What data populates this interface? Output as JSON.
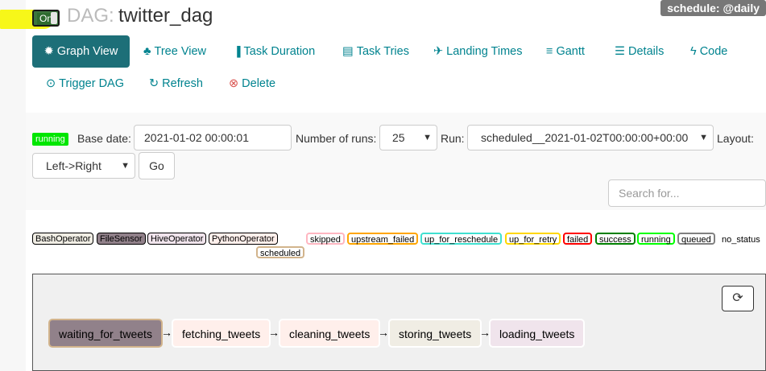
{
  "header": {
    "toggle_label": "On",
    "dag_prefix": "DAG:",
    "dag_id": "twitter_dag",
    "schedule": "schedule: @daily"
  },
  "nav": {
    "graph_view": "Graph View",
    "tree_view": "Tree View",
    "task_duration": "Task Duration",
    "task_tries": "Task Tries",
    "landing_times": "Landing Times",
    "gantt": "Gantt",
    "details": "Details",
    "code": "Code",
    "trigger_dag": "Trigger DAG",
    "refresh": "Refresh",
    "delete": "Delete"
  },
  "controls": {
    "run_state": "running",
    "base_date_label": "Base date:",
    "base_date_value": "2021-01-02 00:00:01",
    "num_runs_label": "Number of runs:",
    "num_runs_value": "25",
    "run_label": "Run:",
    "run_value": "scheduled__2021-01-02T00:00:00+00:00",
    "layout_label": "Layout:",
    "layout_value": "Left->Right",
    "go_label": "Go",
    "search_placeholder": "Search for..."
  },
  "operators": [
    {
      "label": "BashOperator",
      "color": "#f0ede4"
    },
    {
      "label": "FileSensor",
      "color": "#91818a"
    },
    {
      "label": "HiveOperator",
      "color": "#f0e4ec"
    },
    {
      "label": "PythonOperator",
      "color": "#ffefeb"
    }
  ],
  "scheduled_label": "scheduled",
  "states": [
    {
      "label": "skipped",
      "border": "#ffb6c1"
    },
    {
      "label": "upstream_failed",
      "border": "#ffa500"
    },
    {
      "label": "up_for_reschedule",
      "border": "#40e0d0"
    },
    {
      "label": "up_for_retry",
      "border": "#ffd700"
    },
    {
      "label": "failed",
      "border": "#ff0000"
    },
    {
      "label": "success",
      "border": "#008000"
    },
    {
      "label": "running",
      "border": "#00ff00"
    },
    {
      "label": "queued",
      "border": "#808080"
    },
    {
      "label": "no_status",
      "border": "transparent"
    }
  ],
  "tasks": [
    {
      "label": "waiting_for_tweets",
      "color": "#91818a",
      "state_border": "#d2b48c"
    },
    {
      "label": "fetching_tweets",
      "color": "#ffefeb",
      "state_border": "#ffffff"
    },
    {
      "label": "cleaning_tweets",
      "color": "#ffefeb",
      "state_border": "#ffffff"
    },
    {
      "label": "storing_tweets",
      "color": "#f0ede4",
      "state_border": "#ffffff"
    },
    {
      "label": "loading_tweets",
      "color": "#f0e4ec",
      "state_border": "#ffffff"
    }
  ]
}
